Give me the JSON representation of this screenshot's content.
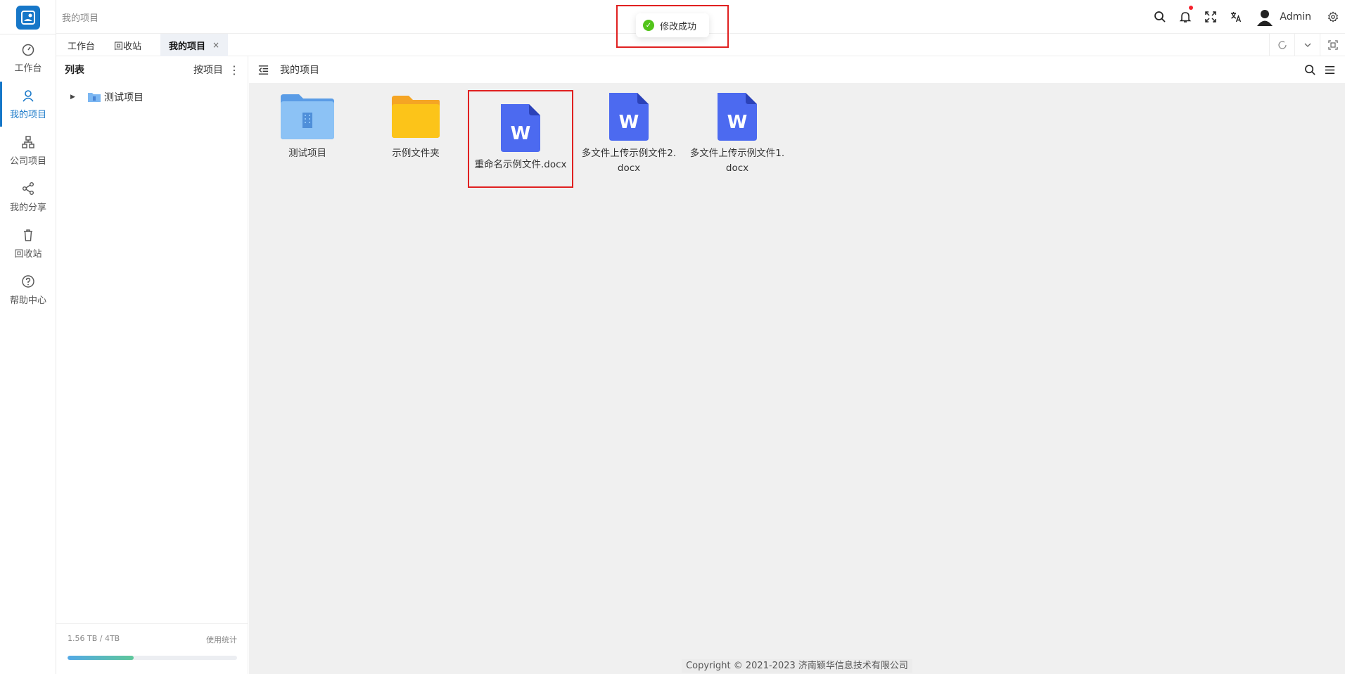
{
  "header": {
    "breadcrumb": "我的项目",
    "user_name": "Admin",
    "icons": [
      "search-icon",
      "bell-icon",
      "fullscreen-icon",
      "translate-icon",
      "avatar",
      "gear-icon"
    ]
  },
  "sidebar": {
    "items": [
      {
        "label": "工作台",
        "icon": "dashboard-icon"
      },
      {
        "label": "我的项目",
        "icon": "user-icon",
        "active": true
      },
      {
        "label": "公司项目",
        "icon": "org-icon"
      },
      {
        "label": "我的分享",
        "icon": "share-icon"
      },
      {
        "label": "回收站",
        "icon": "trash-icon"
      },
      {
        "label": "帮助中心",
        "icon": "help-icon"
      }
    ]
  },
  "tabs": [
    {
      "label": "工作台"
    },
    {
      "label": "回收站"
    },
    {
      "label": "我的项目",
      "active": true,
      "close": "×"
    }
  ],
  "tree": {
    "title": "列表",
    "sort_label": "按项目",
    "nodes": [
      {
        "label": "测试项目"
      }
    ]
  },
  "usage": {
    "text": "1.56 TB / 4TB",
    "link": "使用统计",
    "fraction": 0.39
  },
  "main": {
    "path": "我的项目",
    "files": [
      {
        "name": "测试项目",
        "type": "project-folder"
      },
      {
        "name": "示例文件夹",
        "type": "folder"
      },
      {
        "name": "重命名示例文件.docx",
        "type": "word",
        "selected": true
      },
      {
        "name": "多文件上传示例文件2.docx",
        "type": "word"
      },
      {
        "name": "多文件上传示例文件1.docx",
        "type": "word"
      }
    ]
  },
  "footer": {
    "copyright": "Copyright © 2021-2023 济南颖华信息技术有限公司"
  },
  "toast": {
    "message": "修改成功",
    "status": "success"
  },
  "colors": {
    "accent": "#1677c8",
    "word": "#4c6af0",
    "folder": "#fcc419",
    "project_folder": "#7cb7f2",
    "success": "#52c41a",
    "highlight": "#e02020"
  }
}
